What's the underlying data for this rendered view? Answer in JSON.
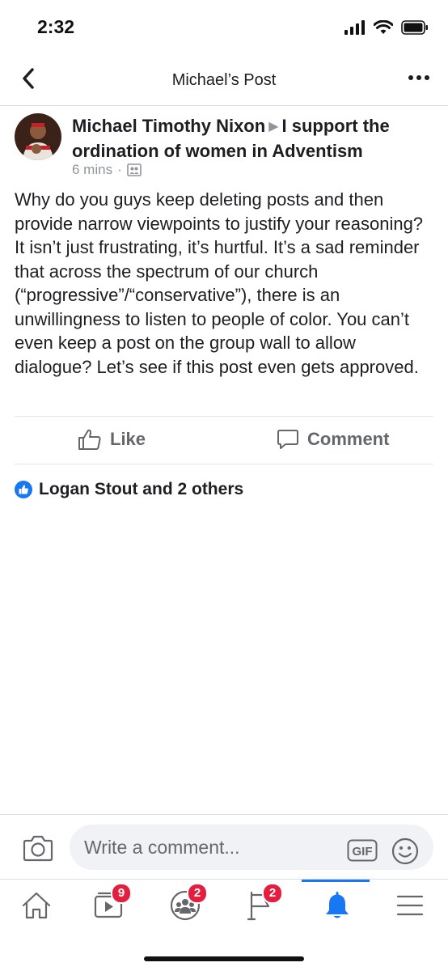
{
  "status_bar": {
    "time": "2:32"
  },
  "nav": {
    "title": "Michael’s Post"
  },
  "post": {
    "author": "Michael Timothy Nixon",
    "group": "I support the ordination of women in Adventism",
    "time": "6 mins",
    "separator": "·",
    "body": "Why do you guys keep deleting posts and then provide narrow viewpoints to justify your reasoning? It isn’t just frustrating, it’s hurtful. It’s a sad reminder that across the spectrum of our church (“progressive”/“conservative”), there is an unwillingness to listen to people of color. You can’t even keep a post on the group wall to allow dialogue? Let’s see if this post even gets approved."
  },
  "actions": {
    "like_label": "Like",
    "comment_label": "Comment"
  },
  "reactions": {
    "text": "Logan Stout and 2 others"
  },
  "composer": {
    "placeholder": "Write a comment...",
    "gif_label": "GIF"
  },
  "tab_bar": {
    "items": [
      {
        "name": "home",
        "icon": "home-icon"
      },
      {
        "name": "watch",
        "icon": "video-icon",
        "badge": "9"
      },
      {
        "name": "groups",
        "icon": "groups-icon",
        "badge": "2"
      },
      {
        "name": "pages",
        "icon": "flag-icon",
        "badge": "2"
      },
      {
        "name": "notifications",
        "icon": "bell-icon",
        "active": true
      },
      {
        "name": "menu",
        "icon": "menu-icon"
      }
    ]
  },
  "colors": {
    "accent": "#1877f2",
    "badge": "#e41e3f",
    "secondary_text": "#65676b"
  }
}
